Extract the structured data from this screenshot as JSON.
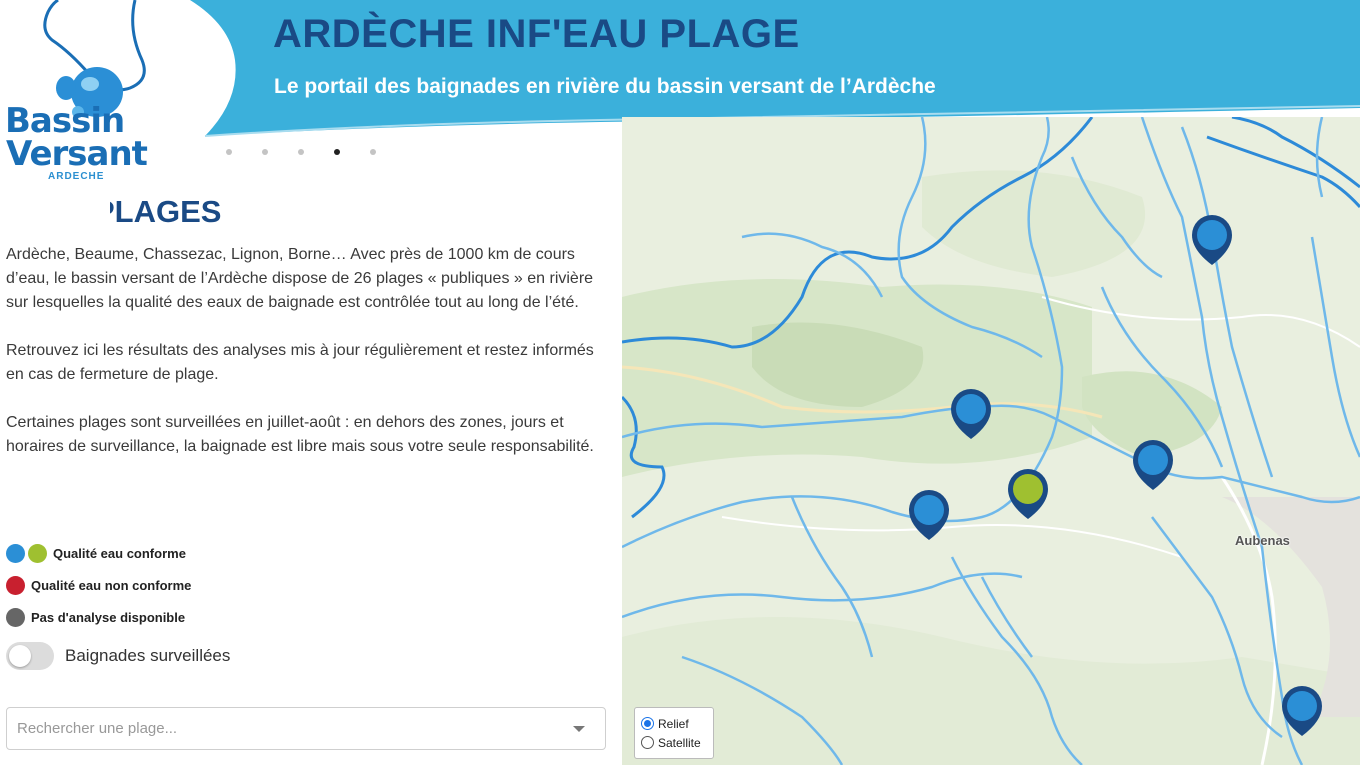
{
  "header": {
    "title": "ARDÈCHE INF'EAU PLAGE",
    "subtitle": "Le portail des baignades en rivière du bassin versant de l’Ardèche"
  },
  "logo": {
    "line1": "Bassin",
    "line2": "Versant",
    "line3": "ARDECHE"
  },
  "carousel": {
    "count": 5,
    "active_index": 3
  },
  "section": {
    "heading": "PLAGES",
    "paragraphs": [
      "Ardèche, Beaume, Chassezac, Lignon, Borne… Avec près de 1000 km de cours d’eau, le bassin versant de l’Ardèche dispose de 26 plages « publiques » en rivière sur lesquelles la qualité des eaux de baignade est contrôlée tout au long de l’été.",
      "Retrouvez ici les résultats des analyses mis à jour régulièrement et restez informés en cas de fermeture de plage.",
      "Certaines plages sont surveillées en juillet-août : en dehors des zones, jours et horaires de surveillance, la baignade est libre mais sous votre seule responsabilité."
    ]
  },
  "legend": {
    "items": [
      {
        "label": "Qualité eau conforme",
        "colors": [
          "#2b8fd6",
          "#9fc030"
        ]
      },
      {
        "label": "Qualité eau non conforme",
        "colors": [
          "#c8202f"
        ]
      },
      {
        "label": "Pas d'analyse disponible",
        "colors": [
          "#666666"
        ]
      }
    ]
  },
  "toggle": {
    "label": "Baignades surveillées",
    "checked": false
  },
  "search": {
    "placeholder": "Rechercher une plage..."
  },
  "map": {
    "town_label": "Aubenas",
    "layers": {
      "relief_label": "Relief",
      "satellite_label": "Satellite",
      "selected": "Relief"
    },
    "marker_colors": {
      "conforme": "#2b8fd6",
      "conforme_surveillee": "#9fc030",
      "outline": "#1a4a85"
    }
  },
  "colors": {
    "header_blue": "#3bb0db",
    "title_navy": "#1a4a85",
    "river": "#6fb8ea",
    "river_major": "#2d8ad8"
  }
}
